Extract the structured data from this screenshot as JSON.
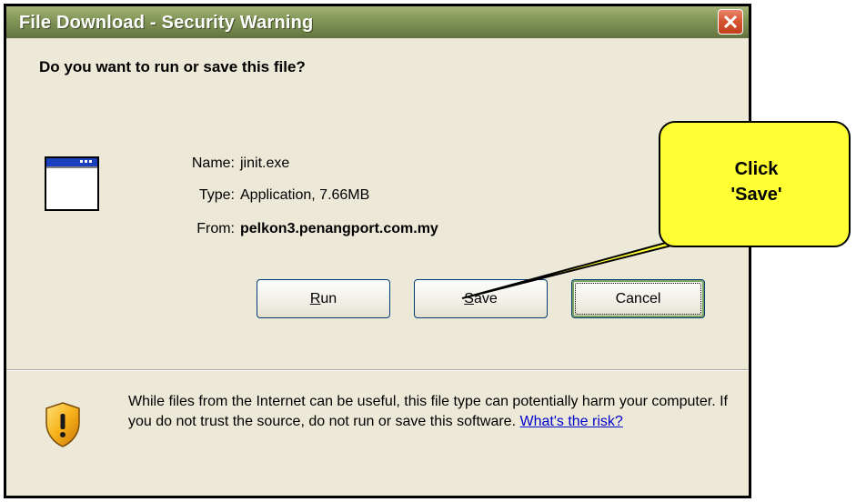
{
  "dialog": {
    "title": "File Download - Security Warning",
    "question": "Do you want to run or save this file?",
    "info": {
      "name_label": "Name:",
      "name_value": "jinit.exe",
      "type_label": "Type:",
      "type_value": "Application, 7.66MB",
      "from_label": "From:",
      "from_value": "pelkon3.penangport.com.my"
    },
    "buttons": {
      "run_mnemonic": "R",
      "run_rest": "un",
      "save_mnemonic": "S",
      "save_rest": "ave",
      "cancel": "Cancel"
    },
    "warning_text": "While files from the Internet can be useful, this file type can potentially harm your computer. If you do not trust the source, do not run or save this software.",
    "risk_link": "What's the risk?"
  },
  "callout": {
    "line1": "Click",
    "line2": "'Save'"
  },
  "icons": {
    "close": "close-icon",
    "app": "application-window-icon",
    "shield": "security-shield-icon"
  },
  "colors": {
    "titlebar": "#7f9255",
    "dialog_bg": "#ece9d8",
    "callout_bg": "#ffff33",
    "close_button": "#d6532f",
    "link": "#0000cc"
  }
}
